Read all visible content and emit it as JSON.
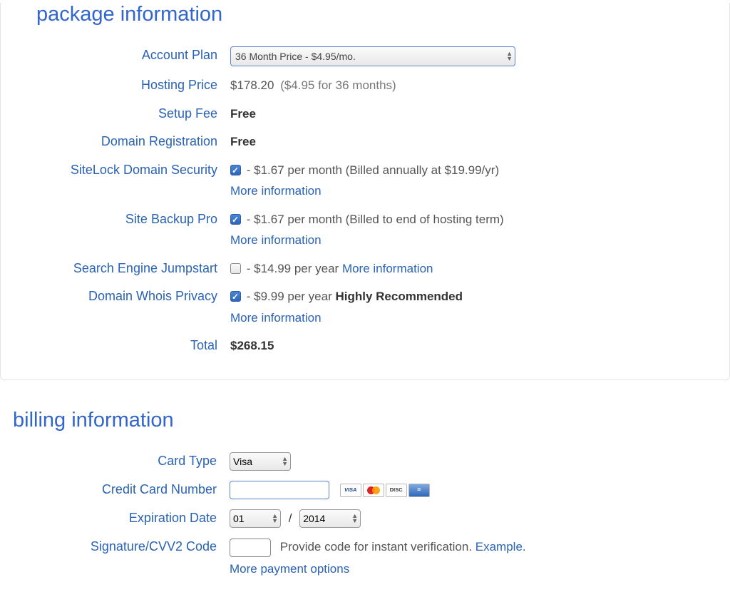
{
  "package": {
    "title": "package information",
    "rows": {
      "account_plan_label": "Account Plan",
      "account_plan_value": "36 Month Price - $4.95/mo.",
      "hosting_price_label": "Hosting Price",
      "hosting_price_value": "$178.20",
      "hosting_price_note": "($4.95 for 36 months)",
      "setup_fee_label": "Setup Fee",
      "setup_fee_value": "Free",
      "domain_reg_label": "Domain Registration",
      "domain_reg_value": "Free",
      "sitelock_label": "SiteLock Domain Security",
      "sitelock_value": "- $1.67 per month (Billed annually at $19.99/yr)",
      "sitebackup_label": "Site Backup Pro",
      "sitebackup_value": "- $1.67 per month (Billed to end of hosting term)",
      "search_jump_label": "Search Engine Jumpstart",
      "search_jump_value": "- $14.99 per year ",
      "whois_label": "Domain Whois Privacy",
      "whois_value_pre": "- $9.99 per year ",
      "whois_value_bold": "Highly Recommended",
      "total_label": "Total",
      "total_value": "$268.15",
      "more_info": "More information"
    }
  },
  "billing": {
    "title": "billing information",
    "card_type_label": "Card Type",
    "card_type_value": "Visa",
    "cc_number_label": "Credit Card Number",
    "expiration_label": "Expiration Date",
    "exp_month": "01",
    "exp_year": "2014",
    "cvv_label": "Signature/CVV2 Code",
    "cvv_note": "Provide code for instant verification. ",
    "cvv_example": "Example.",
    "more_payment": "More payment options"
  }
}
